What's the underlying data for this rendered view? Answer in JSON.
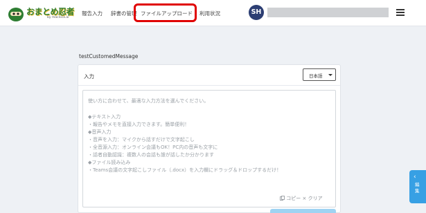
{
  "header": {
    "logo_text": "おまとめ忍者",
    "logo_sub": "by macnica.ai",
    "nav": [
      {
        "label": "報告入力"
      },
      {
        "label": "辞書の管理"
      },
      {
        "label": "ファイルアップロード"
      },
      {
        "label": "利用状況"
      }
    ],
    "avatar_initials": "SH",
    "menu_icon": "hamburger-menu-icon"
  },
  "main": {
    "custom_message": "testCustomedMessage",
    "card": {
      "title": "入力",
      "language": "日本語",
      "placeholder_lines": [
        "使い方に合わせて、最適な入力方法を選んでください。",
        "",
        "◆テキスト入力",
        "・報告やメモを直接入力できます。簡単便利！",
        "◆音声入力",
        "・音声を入力：マイクから話すだけで文字起こし",
        "・全音源入力：オンライン会議もOK！PC内の音声も文字に",
        "・話者自動認識：複数人の会話も誰が話したか分かります",
        "◆ファイル読み込み",
        "・Teams会議の文字起こしファイル（.docx）を入力欄にドラッグ＆ドロップするだけ！"
      ],
      "copy_label": "コピー",
      "clear_label": "クリア",
      "copy_icon": "copy-icon",
      "clear_icon": "close-icon"
    }
  },
  "side_tab": {
    "label": "編集",
    "icon": "chevron-left-icon"
  },
  "colors": {
    "highlight": "#e00000",
    "accent": "#37a0e4",
    "avatar": "#2c3e73"
  }
}
